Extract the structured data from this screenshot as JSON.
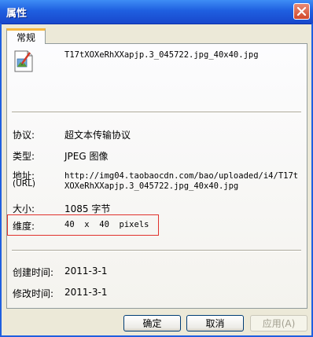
{
  "window": {
    "title": "属性"
  },
  "tabs": [
    {
      "label": "常规"
    }
  ],
  "file": {
    "name": "T17tXOXeRhXXapjp.3_045722.jpg_40x40.jpg"
  },
  "properties": {
    "protocol": {
      "label": "协议:",
      "value": "超文本传输协议"
    },
    "type": {
      "label": "类型:",
      "value": "JPEG 图像"
    },
    "address": {
      "label": "地址:",
      "label_sub": "(URL)",
      "line1": "http://img04.taobaocdn.com/bao/uploaded/i4/T17t",
      "line2": "XOXeRhXXapjp.3_045722.jpg_40x40.jpg"
    },
    "size": {
      "label": "大小:",
      "value": "1085 字节"
    },
    "dimensions": {
      "label": "维度:",
      "value": "40  x  40  pixels"
    },
    "created": {
      "label": "创建时间:",
      "value": "2011-3-1"
    },
    "modified": {
      "label": "修改时间:",
      "value": "2011-3-1"
    }
  },
  "buttons": {
    "ok": "确定",
    "cancel": "取消",
    "apply": "应用(A)"
  },
  "colors": {
    "titlebar": "#1f5fe0",
    "highlight": "#e0322c",
    "tab_accent": "#f6b73e"
  }
}
